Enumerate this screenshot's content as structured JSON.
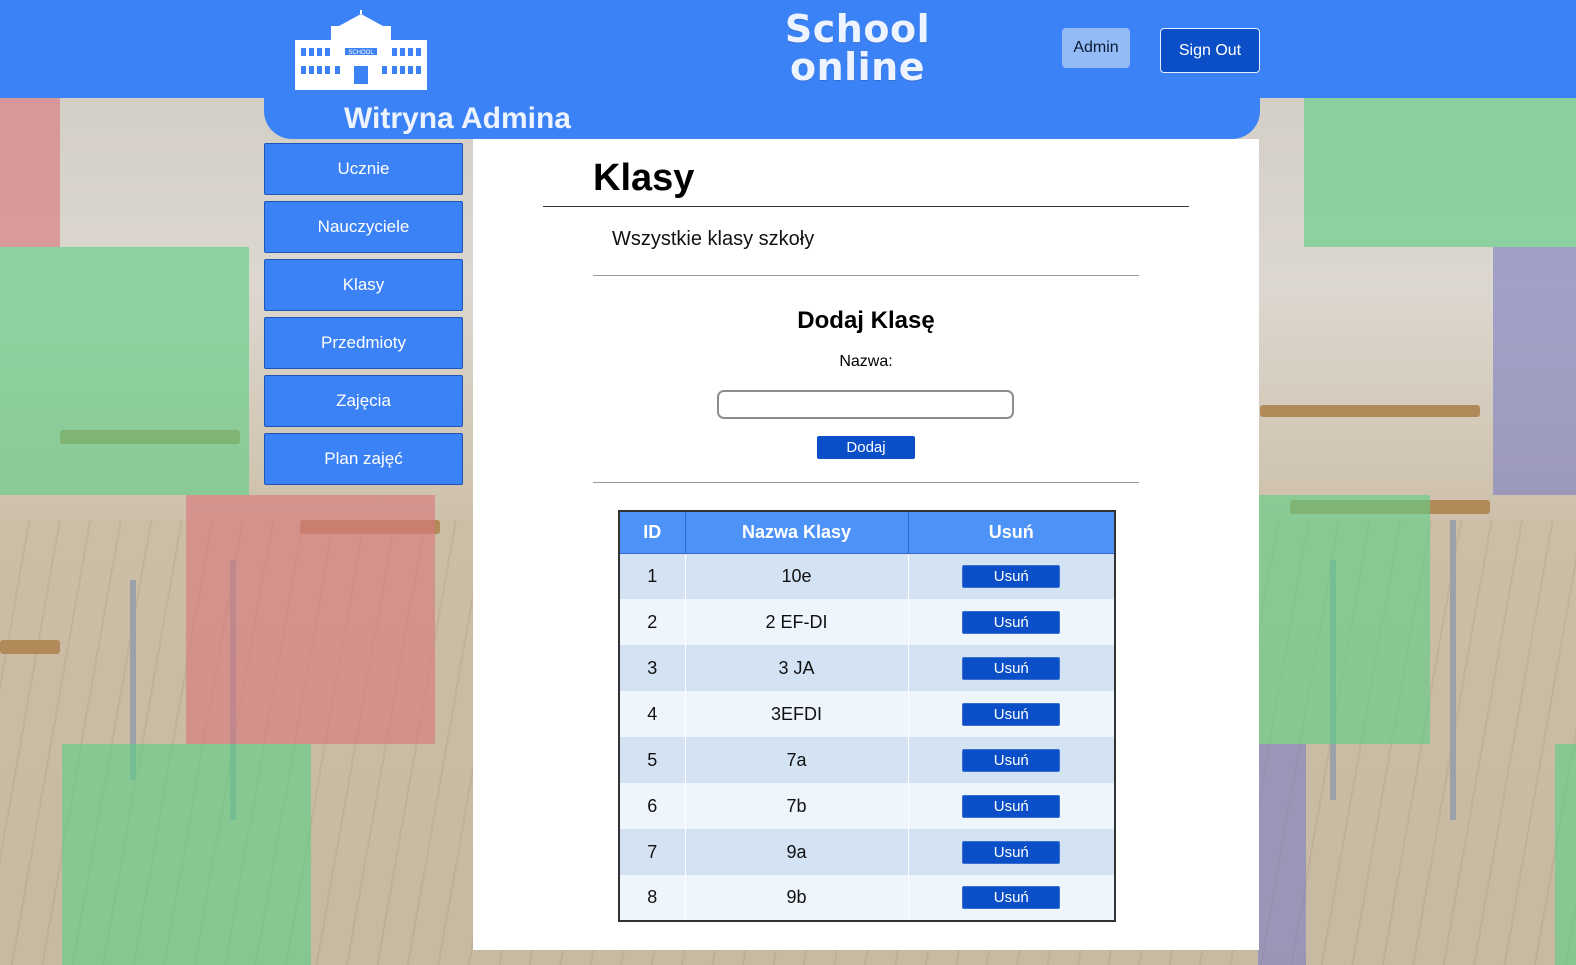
{
  "header": {
    "logo_text": "SCHOOL",
    "brand_line1": "School",
    "brand_line2": "online",
    "admin_label": "Admin",
    "signout_label": "Sign Out"
  },
  "banner": {
    "title": "Witryna Admina"
  },
  "sidebar": {
    "items": [
      {
        "label": "Ucznie"
      },
      {
        "label": "Nauczyciele"
      },
      {
        "label": "Klasy"
      },
      {
        "label": "Przedmioty"
      },
      {
        "label": "Zajęcia"
      },
      {
        "label": "Plan zajęć"
      }
    ]
  },
  "main": {
    "title": "Klasy",
    "subtitle": "Wszystkie klasy szkoły",
    "form": {
      "title": "Dodaj Klasę",
      "name_label": "Nazwa:",
      "name_value": "",
      "submit_label": "Dodaj"
    },
    "table": {
      "headers": {
        "id": "ID",
        "name": "Nazwa Klasy",
        "delete": "Usuń"
      },
      "rows": [
        {
          "id": "1",
          "name": "10e",
          "delete_label": "Usuń"
        },
        {
          "id": "2",
          "name": "2 EF-DI",
          "delete_label": "Usuń"
        },
        {
          "id": "3",
          "name": "3 JA",
          "delete_label": "Usuń"
        },
        {
          "id": "4",
          "name": "3EFDI",
          "delete_label": "Usuń"
        },
        {
          "id": "5",
          "name": "7a",
          "delete_label": "Usuń"
        },
        {
          "id": "6",
          "name": "7b",
          "delete_label": "Usuń"
        },
        {
          "id": "7",
          "name": "9a",
          "delete_label": "Usuń"
        },
        {
          "id": "8",
          "name": "9b",
          "delete_label": "Usuń"
        }
      ]
    }
  },
  "colors": {
    "primary": "#3b82f6",
    "button_dark": "#0b4fc8",
    "table_header": "#4d92f7",
    "row_odd": "#d4e3f4",
    "row_even": "#eef5fd"
  }
}
